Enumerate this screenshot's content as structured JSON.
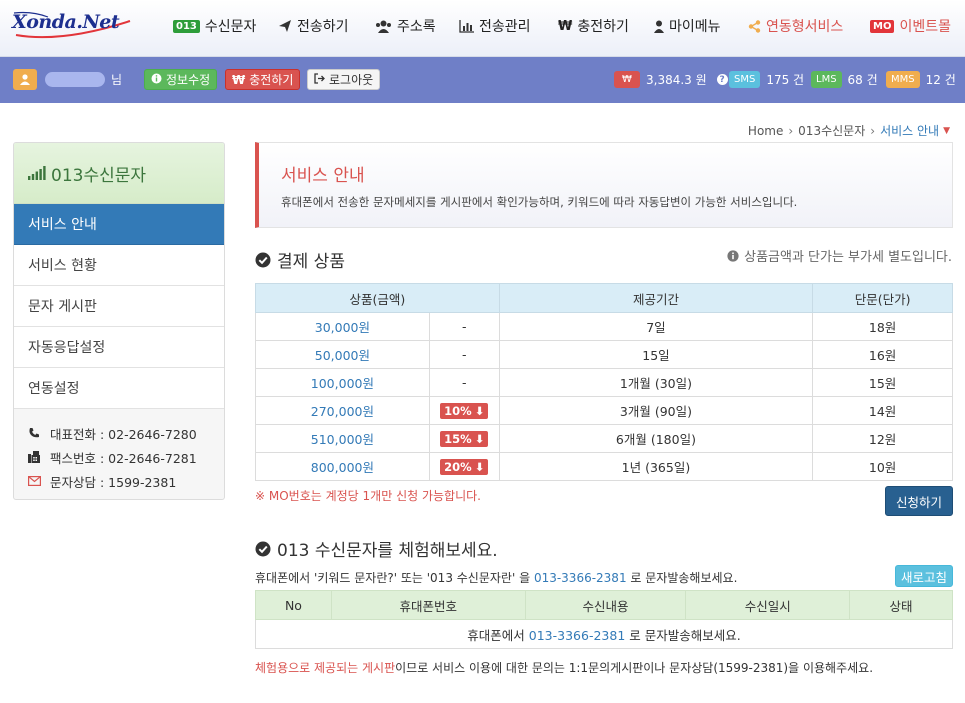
{
  "brand": {
    "logo_text": "Xonda.Net"
  },
  "nav": [
    {
      "label": "수신문자",
      "badge": "013"
    },
    {
      "label": "전송하기"
    },
    {
      "label": "주소록"
    },
    {
      "label": "전송관리"
    },
    {
      "label": "충전하기"
    },
    {
      "label": "마이메뉴"
    },
    {
      "label": "연동형서비스"
    },
    {
      "label": "이벤트몰",
      "badge": "MO"
    }
  ],
  "userbar": {
    "suffix": "님",
    "edit_label": "정보수정",
    "charge_label": "충전하기",
    "logout_label": "로그아웃",
    "balance_symbol": "₩",
    "balance": "3,384.3 원",
    "help": "?",
    "credits": [
      {
        "label": "SMS",
        "value": "175 건",
        "color": "#5bc0de"
      },
      {
        "label": "LMS",
        "value": "68 건",
        "color": "#5cb85c"
      },
      {
        "label": "MMS",
        "value": "12 건",
        "color": "#f0ad4e"
      }
    ]
  },
  "sidebar": {
    "title": "013수신문자",
    "items": [
      {
        "label": "서비스 안내",
        "active": true
      },
      {
        "label": "서비스 현황"
      },
      {
        "label": "문자 게시판"
      },
      {
        "label": "자동응답설정"
      },
      {
        "label": "연동설정"
      }
    ],
    "contacts": [
      {
        "text": "대표전화 : 02-2646-7280"
      },
      {
        "text": "팩스번호 : 02-2646-7281"
      },
      {
        "text": "문자상담 : 1599-2381"
      }
    ]
  },
  "breadcrumb": {
    "home": "Home",
    "section": "013수신문자",
    "current": "서비스 안내"
  },
  "info": {
    "title": "서비스 안내",
    "desc": "휴대폰에서 전송한 문자메세지를 게시판에서 확인가능하며, 키워드에 따라 자동답변이 가능한 서비스입니다."
  },
  "products": {
    "title": "결제 상품",
    "vat_note": "상품금액과 단가는 부가세 별도입니다.",
    "headers": [
      "상품(금액)",
      "제공기간",
      "단문(단가)"
    ],
    "rows": [
      {
        "price": "30,000원",
        "discount": "-",
        "period": "7일",
        "unit": "18원"
      },
      {
        "price": "50,000원",
        "discount": "-",
        "period": "15일",
        "unit": "16원"
      },
      {
        "price": "100,000원",
        "discount": "-",
        "period": "1개월 (30일)",
        "unit": "15원"
      },
      {
        "price": "270,000원",
        "discount": "10%",
        "period": "3개월 (90일)",
        "unit": "14원"
      },
      {
        "price": "510,000원",
        "discount": "15%",
        "period": "6개월 (180일)",
        "unit": "12원"
      },
      {
        "price": "800,000원",
        "discount": "20%",
        "period": "1년 (365일)",
        "unit": "10원"
      }
    ],
    "mo_note": "※ MO번호는 계정당 1개만 신청 가능합니다.",
    "apply_label": "신청하기"
  },
  "trial": {
    "title": "013 수신문자를 체험해보세요.",
    "desc_pre": "휴대폰에서 '키워드 문자란?' 또는 '013 수신문자란' 을 ",
    "number": "013-3366-2381",
    "desc_post": " 로 문자발송해보세요.",
    "refresh_label": "새로고침",
    "headers": [
      "No",
      "휴대폰번호",
      "수신내용",
      "수신일시",
      "상태"
    ],
    "empty_pre": "휴대폰에서 ",
    "empty_post": " 로 문자발송해보세요.",
    "footer_red": "체험용으로 제공되는 게시판",
    "footer_rest": "이므로 서비스 이용에 대한 문의는 1:1문의게시판이나 문자상담(1599-2381)을 이용해주세요."
  }
}
